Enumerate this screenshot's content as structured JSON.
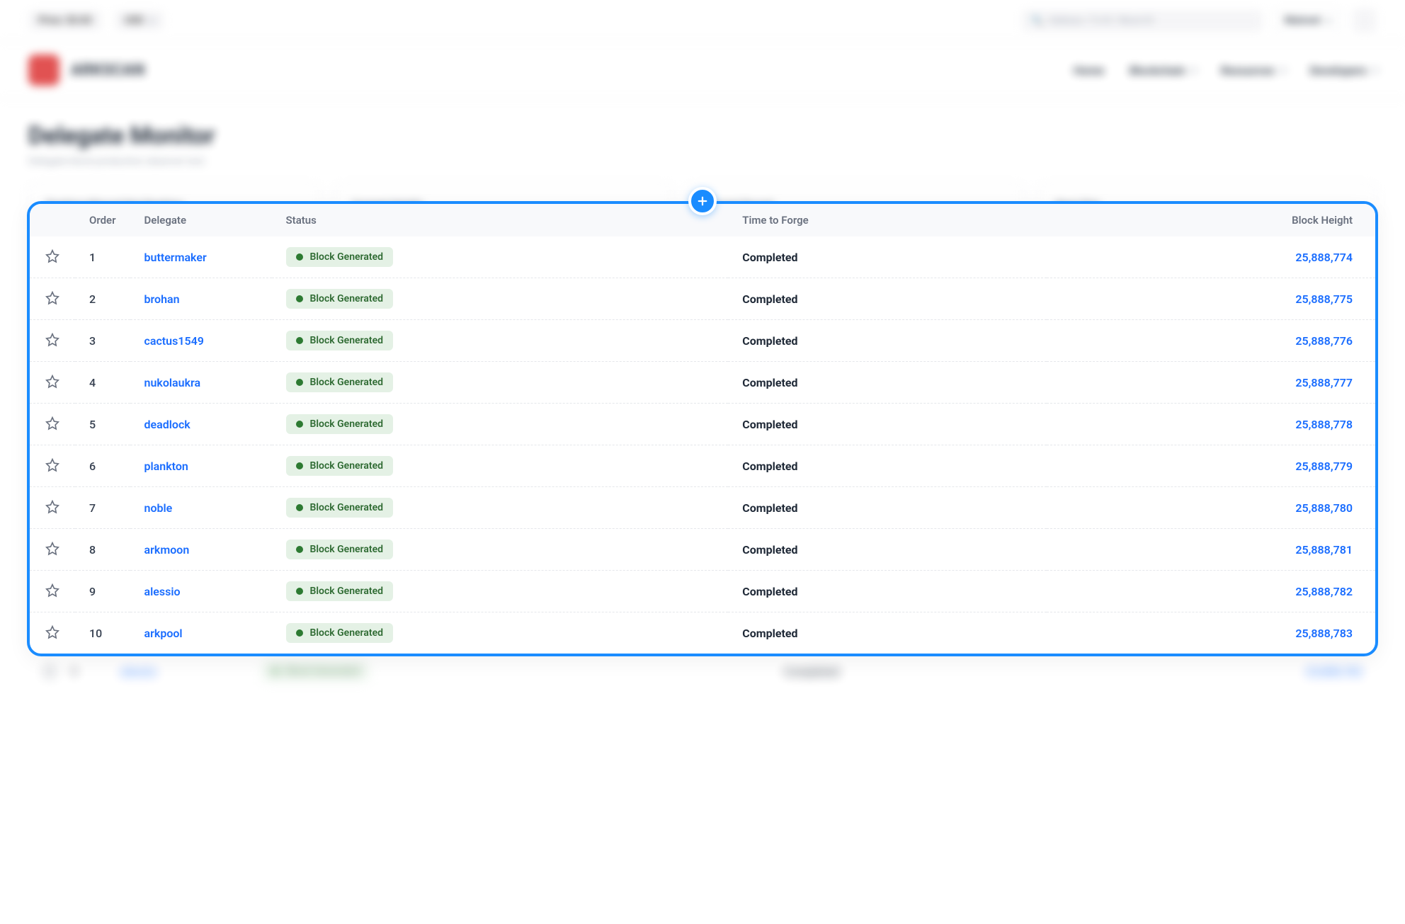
{
  "topbar": {
    "price_label": "Price: $0.83",
    "currency": "USD",
    "search_placeholder": "Address / Tx ID / Block ID",
    "network": "Mainnet"
  },
  "brand": {
    "name": "ARKSCAN"
  },
  "nav": {
    "home": "Home",
    "blockchain": "Blockchain",
    "resources": "Resources",
    "developers": "Developers"
  },
  "page": {
    "title": "Delegate Monitor",
    "subtitle": "Delegate block production observer tool."
  },
  "stat_cards": {
    "c1": "Ranking   Missed   Not Ranking",
    "c2": "Current Height",
    "c3": "Current Round",
    "c4": "Next Slot"
  },
  "columns": {
    "order": "Order",
    "delegate": "Delegate",
    "status": "Status",
    "time": "Time to Forge",
    "height": "Block Height"
  },
  "status_label": "Block Generated",
  "rows": [
    {
      "order": "1",
      "delegate": "buttermaker",
      "time": "Completed",
      "height": "25,888,774"
    },
    {
      "order": "2",
      "delegate": "brohan",
      "time": "Completed",
      "height": "25,888,775"
    },
    {
      "order": "3",
      "delegate": "cactus1549",
      "time": "Completed",
      "height": "25,888,776"
    },
    {
      "order": "4",
      "delegate": "nukolaukra",
      "time": "Completed",
      "height": "25,888,777"
    },
    {
      "order": "5",
      "delegate": "deadlock",
      "time": "Completed",
      "height": "25,888,778"
    },
    {
      "order": "6",
      "delegate": "plankton",
      "time": "Completed",
      "height": "25,888,779"
    },
    {
      "order": "7",
      "delegate": "noble",
      "time": "Completed",
      "height": "25,888,780"
    },
    {
      "order": "8",
      "delegate": "arkmoon",
      "time": "Completed",
      "height": "25,888,781"
    },
    {
      "order": "9",
      "delegate": "alessio",
      "time": "Completed",
      "height": "25,888,782"
    },
    {
      "order": "10",
      "delegate": "arkpool",
      "time": "Completed",
      "height": "25,888,783"
    }
  ],
  "blur_row": {
    "order": "9",
    "delegate": "alessio",
    "time": "Completed",
    "height": "25,888,782"
  }
}
